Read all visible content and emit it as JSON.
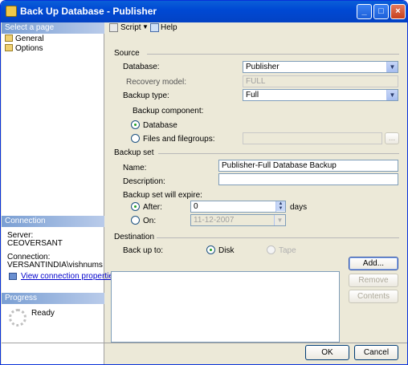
{
  "window": {
    "title": "Back Up Database - Publisher",
    "min": "_",
    "max": "□",
    "close": "×"
  },
  "left": {
    "select_page": "Select a page",
    "pages": [
      {
        "label": "General"
      },
      {
        "label": "Options"
      }
    ],
    "connection_header": "Connection",
    "server_label": "Server:",
    "server_value": "CEOVERSANT",
    "connection_label": "Connection:",
    "connection_value": "VERSANTINDIA\\vishnums",
    "view_connection": "View connection properties",
    "progress_header": "Progress",
    "progress_status": "Ready"
  },
  "toolbar": {
    "script": "Script",
    "help": "Help"
  },
  "source": {
    "header": "Source",
    "database_label": "Database:",
    "database_value": "Publisher",
    "recovery_label": "Recovery model:",
    "recovery_value": "FULL",
    "backup_type_label": "Backup type:",
    "backup_type_value": "Full",
    "component_label": "Backup component:",
    "component_database": "Database",
    "component_files": "Files and filegroups:",
    "files_button": "..."
  },
  "backup_set": {
    "header": "Backup set",
    "name_label": "Name:",
    "name_value": "Publisher-Full Database Backup",
    "description_label": "Description:",
    "description_value": "",
    "expire_label": "Backup set will expire:",
    "after_label": "After:",
    "after_value": "0",
    "days_label": "days",
    "on_label": "On:",
    "on_value": "11-12-2007"
  },
  "destination": {
    "header": "Destination",
    "backup_to_label": "Back up to:",
    "disk": "Disk",
    "tape": "Tape",
    "add": "Add...",
    "remove": "Remove",
    "contents": "Contents"
  },
  "footer": {
    "ok": "OK",
    "cancel": "Cancel"
  }
}
